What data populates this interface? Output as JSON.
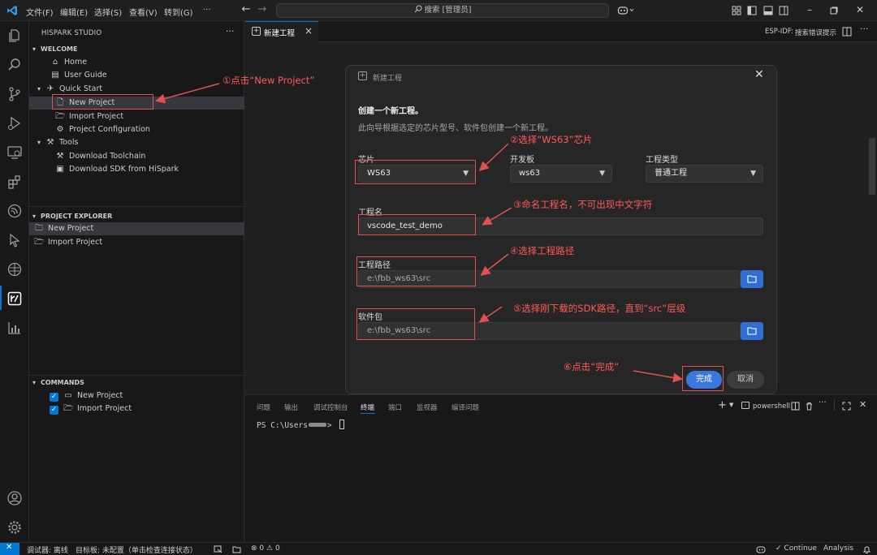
{
  "titlebar": {
    "menus": [
      "文件(F)",
      "编辑(E)",
      "选择(S)",
      "查看(V)",
      "转到(G)",
      "···"
    ],
    "search_text": "搜索 [管理员]"
  },
  "sidebar": {
    "title": "HISPARK STUDIO",
    "more": "···",
    "welcome": {
      "header": "WELCOME",
      "home": "Home",
      "user_guide": "User Guide",
      "quick_start": "Quick Start",
      "new_project": "New Project",
      "import_project": "Import Project",
      "project_configuration": "Project Configuration",
      "tools": "Tools",
      "download_toolchain": "Download Toolchain",
      "download_sdk": "Download SDK from HiSpark"
    },
    "explorer": {
      "header": "PROJECT EXPLORER",
      "new_project": "New Project",
      "import_project": "Import Project"
    },
    "commands": {
      "header": "COMMANDS",
      "new_project": "New Project",
      "import_project": "Import Project"
    }
  },
  "editor": {
    "tab_label": "新建工程",
    "tab_close": "×",
    "esp_idf_label": "ESP-IDF:",
    "esp_idf_action": "搜索错误提示"
  },
  "dialog": {
    "title": "新建工程",
    "heading": "创建一个新工程。",
    "description": "此向导根据选定的芯片型号、软件包创建一个新工程。",
    "chip_label": "芯片",
    "chip_value": "WS63",
    "board_label": "开发板",
    "board_value": "ws63",
    "type_label": "工程类型",
    "type_value": "普通工程",
    "name_label": "工程名",
    "name_value": "vscode_test_demo",
    "path_label": "工程路径",
    "path_value": "e:\\fbb_ws63\\src",
    "package_label": "软件包",
    "package_value": "e:\\fbb_ws63\\src",
    "finish_button": "完成",
    "cancel_button": "取消"
  },
  "annotations": {
    "a1": "①点击“New Project”",
    "a2": "②选择“WS63”芯片",
    "a3": "③命名工程名，不可出现中文字符",
    "a4": "④选择工程路径",
    "a5": "⑤选择刚下载的SDK路径，直到“src”层级",
    "a6": "⑥点击“完成”"
  },
  "panel": {
    "tabs": [
      "问题",
      "输出",
      "调试控制台",
      "终端",
      "端口",
      "监视器",
      "编译问题"
    ],
    "active_tab": "终端",
    "shell_label": "powershell",
    "prompt_prefix": "PS C:\\Users",
    "prompt_suffix": ">"
  },
  "statusbar": {
    "debugger": "调试器: 离线",
    "board": "目标板:  未配置（单击检查连接状态）",
    "problems": "0",
    "warnings": "0",
    "continue": "Continue",
    "analysis": "Analysis"
  },
  "colors": {
    "accent": "#0078d4",
    "annotation_red": "#e05252",
    "primary_button": "#3a78e0"
  }
}
